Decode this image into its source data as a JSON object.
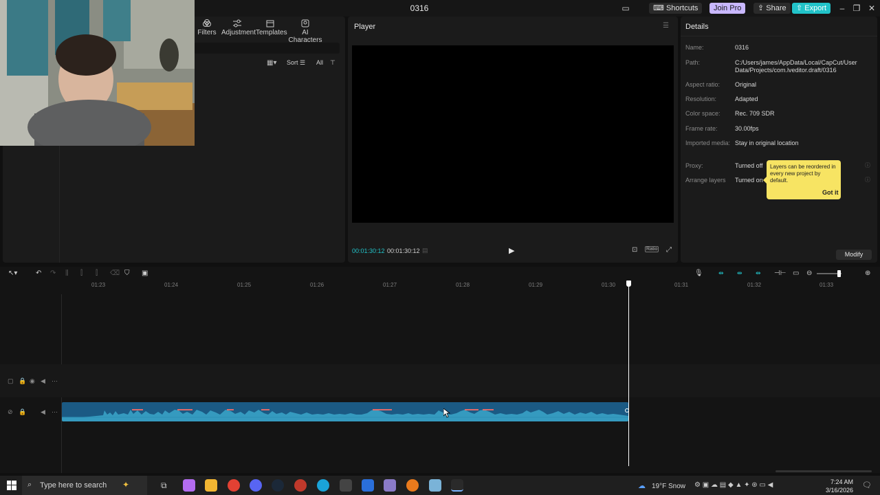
{
  "app": {
    "title": "0316"
  },
  "titlebar": {
    "shortcuts_label": "Shortcuts",
    "joinpro_label": "Join Pro",
    "share_label": "Share",
    "export_label": "Export"
  },
  "media": {
    "tabs": [
      {
        "label": "Filters"
      },
      {
        "label": "Adjustment"
      },
      {
        "label": "Templates"
      },
      {
        "label": "AI Characters"
      }
    ],
    "sort_label": "Sort",
    "all_label": "All"
  },
  "player": {
    "title": "Player",
    "current_time": "00:01:30:12",
    "total_time": "00:01:30:12",
    "ratio_label": "Ratio"
  },
  "details": {
    "title": "Details",
    "rows": [
      {
        "label": "Name:",
        "value": "0316"
      },
      {
        "label": "Path:",
        "value": "C:/Users/james/AppData/Local/CapCut/User Data/Projects/com.lveditor.draft/0316"
      },
      {
        "label": "Aspect ratio:",
        "value": "Original"
      },
      {
        "label": "Resolution:",
        "value": "Adapted"
      },
      {
        "label": "Color space:",
        "value": "Rec. 709 SDR"
      },
      {
        "label": "Frame rate:",
        "value": "30.00fps"
      },
      {
        "label": "Imported media:",
        "value": "Stay in original location"
      },
      {
        "label": "Proxy:",
        "value": "Turned off"
      },
      {
        "label": "Arrange layers",
        "value": "Turned on"
      }
    ],
    "tooltip_text": "Layers can be reordered in every new project by default.",
    "tooltip_button": "Got it",
    "modify_label": "Modify"
  },
  "timeline": {
    "ticks": [
      "01:23",
      "01:24",
      "01:25",
      "01:26",
      "01:27",
      "01:28",
      "01:29",
      "01:30",
      "01:31",
      "01:32",
      "01:33"
    ]
  },
  "taskbar": {
    "search_placeholder": "Type here to search",
    "weather": "19°F  Snow",
    "time": "7:24 AM",
    "date": "3/16/2026"
  },
  "colors": {
    "accent_cyan": "#22c3c9",
    "joinpro": "#c9b8ff",
    "tooltip_yellow": "#f7e463",
    "audio_clip": "#1b5a84",
    "waveform": "#3aa6c9"
  }
}
